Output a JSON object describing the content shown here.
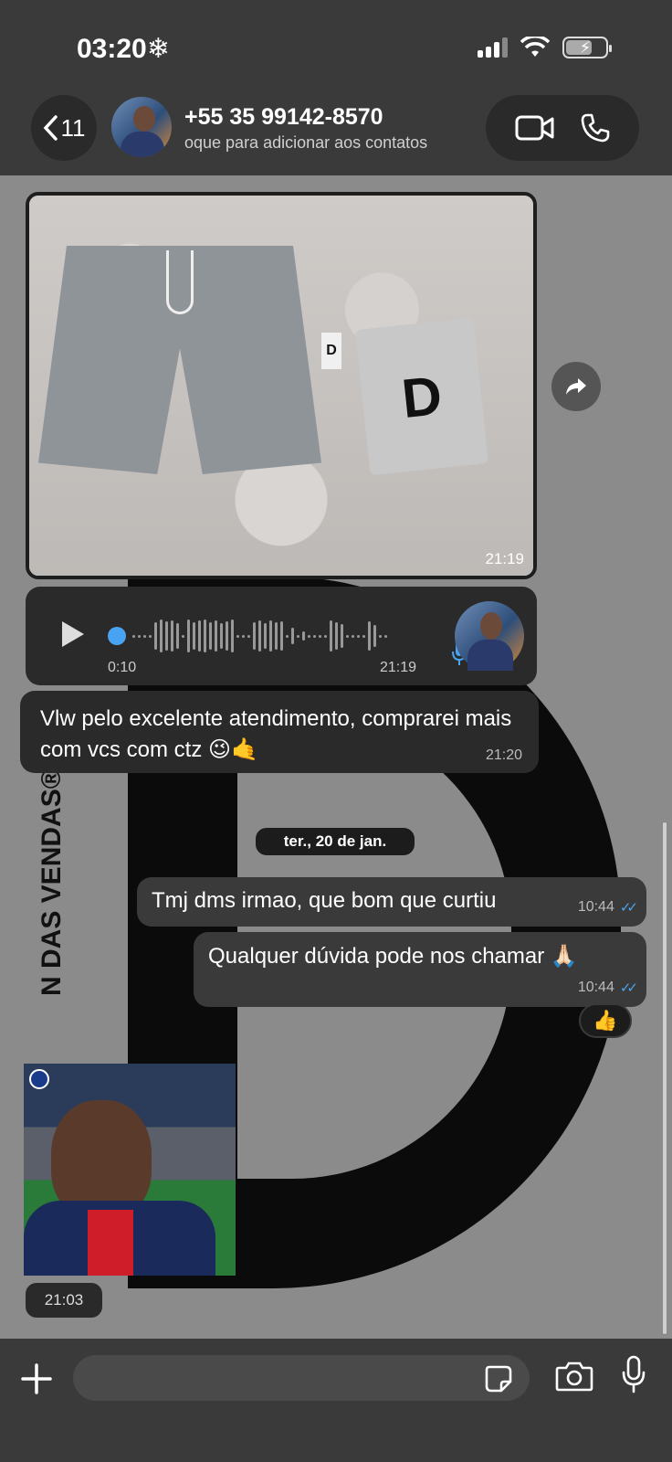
{
  "status_bar": {
    "time": "03:20",
    "snow": "❄"
  },
  "header": {
    "back_count": "11",
    "contact_name": "+55 35 99142-8570",
    "contact_subtitle": "oque para adicionar aos contatos"
  },
  "wallpaper": {
    "vertical_text": "N DAS VENDAS®"
  },
  "messages": {
    "image_time": "21:19",
    "voice": {
      "duration": "0:10",
      "time": "21:19"
    },
    "incoming_text": "Vlw pelo excelente atendimento, comprarei mais com vcs com ctz 😉🤙",
    "incoming_time": "21:20",
    "date_divider": "ter., 20 de jan.",
    "out1_text": "Tmj dms irmao, que bom que curtiu",
    "out1_time": "10:44",
    "out2_text": "Qualquer dúvida pode nos chamar 🙏🏻",
    "out2_time": "10:44",
    "reaction": "👍",
    "sticker_time": "21:03"
  },
  "colors": {
    "bubble": "#2a2a2a",
    "outgoing": "#3a3a3a",
    "read_ticks": "#4aa3f0"
  }
}
